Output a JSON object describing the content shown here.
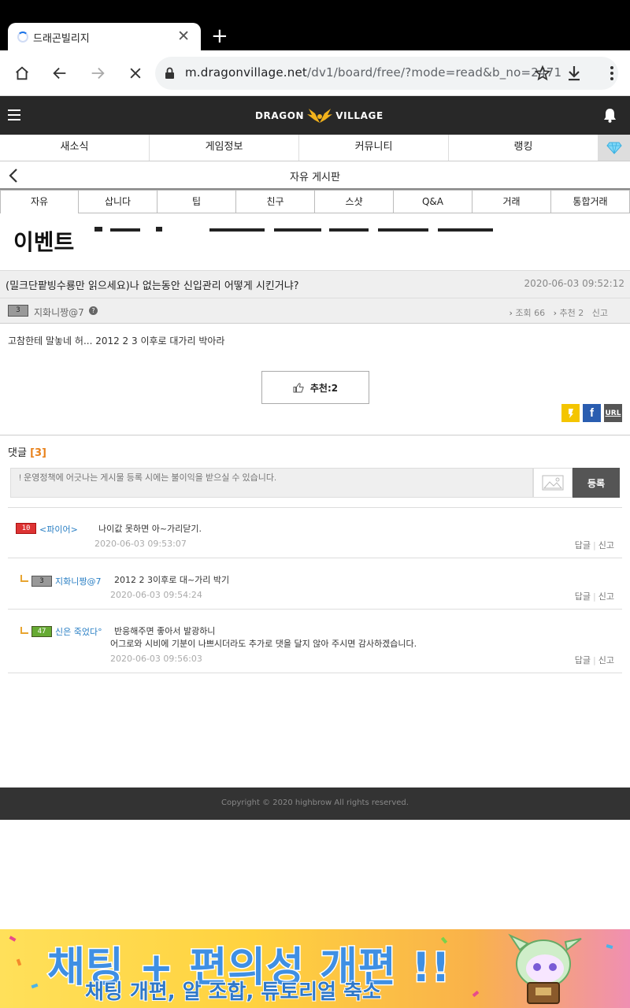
{
  "browser": {
    "tab_title": "드래곤빌리지",
    "url_host": "m.dragonvillage.net",
    "url_path": "/dv1/board/free/?mode=read&b_no=2471"
  },
  "site": {
    "logo_left": "DRAGON",
    "logo_right": "VILLAGE",
    "main_nav": [
      "새소식",
      "게임정보",
      "커뮤니티",
      "랭킹"
    ],
    "board_title": "자유 게시판",
    "sub_nav": [
      "자유",
      "삽니다",
      "팁",
      "친구",
      "스샷",
      "Q&A",
      "거래",
      "통합거래"
    ],
    "event_label": "이벤트"
  },
  "post": {
    "subject": "(밀크단팥빙수룡만 읽으세요)나 없는동안 신입관리 어떻게 시킨거냐?",
    "date": "2020-06-03 09:52:12",
    "author": {
      "level": "3",
      "name": "지화니짱@7"
    },
    "stats": {
      "views_label": "조회 66",
      "recommend_label": "추천 2",
      "report_label": "신고"
    },
    "body": "고참한테 말놓네 허... 2012 2 3 이후로 대가리 박아라",
    "recommend_button": "추천:2",
    "share": {
      "kakao": "kakaostory-icon",
      "facebook": "f",
      "url": "URL"
    }
  },
  "comments_section": {
    "title": "댓글",
    "count": "[3]",
    "input_placeholder": "! 운영정책에 어긋나는 게시물 등록 시에는 불이익을 받으실 수 있습니다.",
    "submit_label": "등록",
    "reply_label": "답글",
    "report_label": "신고",
    "items": [
      {
        "level": "10",
        "name": "<파이어>",
        "text": "나이값 못하면 아~가리닫기.",
        "time": "2020-06-03 09:53:07"
      },
      {
        "level": "3",
        "name": "지화니짱@7",
        "text": "2012 2 3이후로 대~가리 박기",
        "time": "2020-06-03 09:54:24"
      },
      {
        "level": "47",
        "name": "신은 죽었다°",
        "text_line1": "반응해주면 좋아서 발광하니",
        "text_line2": "어그로와 시비에 기분이 나쁘시더라도 추가로 댓을 달지 않아 주시면 감사하겠습니다.",
        "time": "2020-06-03 09:56:03"
      }
    ]
  },
  "footer": {
    "copyright": "Copyright © 2020 highbrow All rights reserved."
  },
  "banner": {
    "headline": "채팅 + 편의성 개편 !!",
    "subline": "채팅 개편, 알 조합, 튜토리얼 축소"
  },
  "colors": {
    "accent_orange": "#e8821c",
    "link_blue": "#2a7fc4",
    "header_dark": "#282828"
  }
}
